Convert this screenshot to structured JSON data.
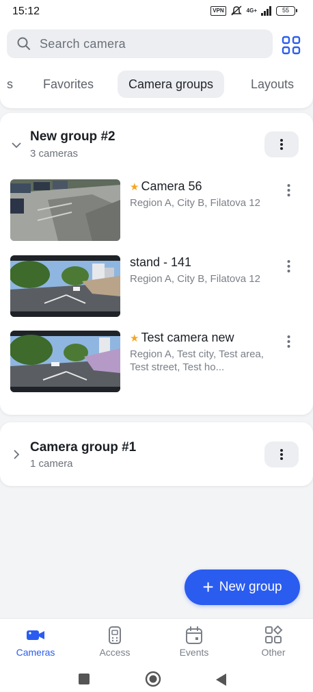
{
  "status": {
    "time": "15:12",
    "vpn": "VPN",
    "network": "4G+",
    "battery": "55"
  },
  "search": {
    "placeholder": "Search camera"
  },
  "tabs": [
    {
      "label": "s"
    },
    {
      "label": "Favorites"
    },
    {
      "label": "Camera groups",
      "active": true
    },
    {
      "label": "Layouts"
    }
  ],
  "groups": [
    {
      "title": "New group #2",
      "subtitle": "3 cameras",
      "expanded": true,
      "cameras": [
        {
          "name": "Camera 56",
          "favorite": true,
          "address": "Region A, City B,  Filatova 12"
        },
        {
          "name": "stand - 141",
          "favorite": false,
          "address": "Region A, City B,  Filatova 12"
        },
        {
          "name": "Test camera new",
          "favorite": true,
          "address": "Region A, Test city, Test area, Test street, Test ho..."
        }
      ]
    },
    {
      "title": "Camera group #1",
      "subtitle": "1 camera",
      "expanded": false,
      "cameras": []
    }
  ],
  "fab": {
    "label": "New group",
    "icon": "plus-icon"
  },
  "bottom_nav": [
    {
      "label": "Cameras",
      "icon": "camera-icon",
      "active": true
    },
    {
      "label": "Access",
      "icon": "access-icon",
      "active": false
    },
    {
      "label": "Events",
      "icon": "calendar-icon",
      "active": false
    },
    {
      "label": "Other",
      "icon": "grid-icon",
      "active": false
    }
  ],
  "colors": {
    "accent": "#2a5cf0",
    "star": "#f5a623",
    "background": "#f3f4f6"
  }
}
